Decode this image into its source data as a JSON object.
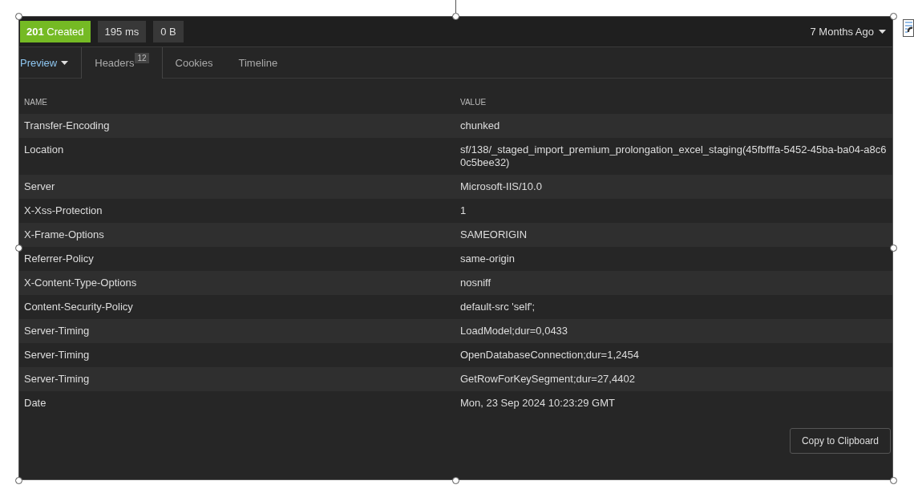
{
  "status": {
    "code": "201",
    "text": "Created"
  },
  "time": "195 ms",
  "size": "0 B",
  "history": "7 Months Ago",
  "tabs": [
    {
      "label": "Preview",
      "selected": false,
      "dropdown": true
    },
    {
      "label": "Headers",
      "selected": true,
      "badge": "12"
    },
    {
      "label": "Cookies",
      "selected": false
    },
    {
      "label": "Timeline",
      "selected": false
    }
  ],
  "table": {
    "columns": [
      "NAME",
      "VALUE"
    ],
    "rows": [
      {
        "name": "Transfer-Encoding",
        "value": "chunked"
      },
      {
        "name": "Location",
        "value": "sf/138/_staged_import_premium_prolongation_excel_staging(45fbfffa-5452-45ba-ba04-a8c60c5bee32)"
      },
      {
        "name": "Server",
        "value": "Microsoft-IIS/10.0"
      },
      {
        "name": "X-Xss-Protection",
        "value": "1"
      },
      {
        "name": "X-Frame-Options",
        "value": "SAMEORIGIN"
      },
      {
        "name": "Referrer-Policy",
        "value": "same-origin"
      },
      {
        "name": "X-Content-Type-Options",
        "value": "nosniff"
      },
      {
        "name": "Content-Security-Policy",
        "value": "default-src 'self';"
      },
      {
        "name": "Server-Timing",
        "value": "LoadModel;dur=0,0433"
      },
      {
        "name": "Server-Timing",
        "value": "OpenDatabaseConnection;dur=1,2454"
      },
      {
        "name": "Server-Timing",
        "value": "GetRowForKeySegment;dur=27,4402"
      },
      {
        "name": "Date",
        "value": "Mon, 23 Sep 2024 10:23:29 GMT"
      }
    ]
  },
  "copy_button": "Copy to Clipboard"
}
